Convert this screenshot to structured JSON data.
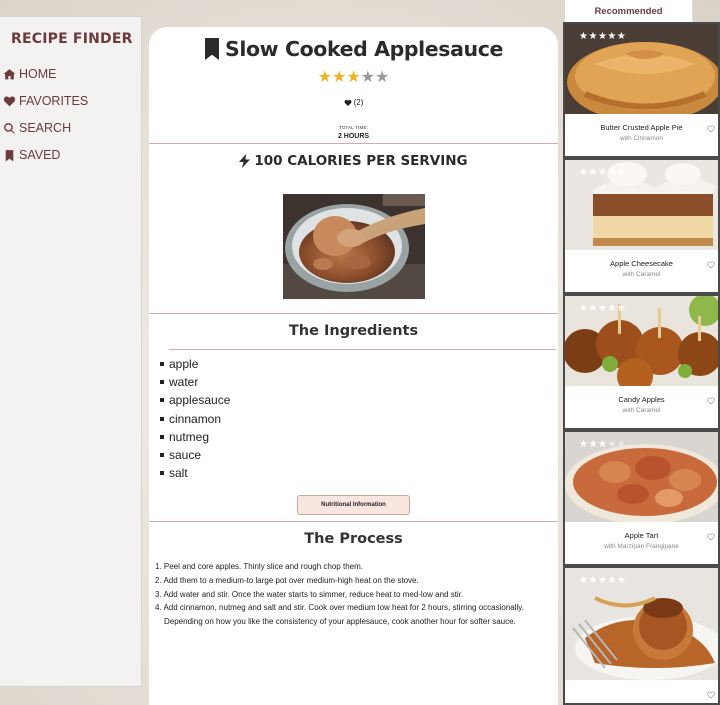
{
  "sidebar": {
    "brand": "RECIPE FINDER",
    "items": [
      {
        "label": "HOME",
        "icon": "home-icon"
      },
      {
        "label": "FAVORITES",
        "icon": "heart-icon"
      },
      {
        "label": "SEARCH",
        "icon": "search-icon"
      },
      {
        "label": "SAVED",
        "icon": "bookmark-icon"
      }
    ]
  },
  "recipe": {
    "title": "Slow Cooked Applesauce",
    "rating": 3,
    "rating_max": 5,
    "likes": "(2)",
    "time_label": "TOTAL TIME:",
    "time_value": "2 HOURS",
    "calories": "100 CALORIES PER SERVING",
    "ingredients_heading": "The Ingredients",
    "ingredients": [
      "apple",
      "water",
      "applesauce",
      "cinnamon",
      "nutmeg",
      "sauce",
      "salt"
    ],
    "nutrition_button": "Nutritional Information",
    "process_heading": "The Process",
    "steps": [
      "1. Peel and core apples. Thinly slice and rough chop them.",
      "2. Add them to a medium-to large pot over medium-high heat on the stove.",
      "3. Add water and stir. Once the water starts to simmer, reduce heat to med-low and stir.",
      "4. Add cinnamon, nutmeg and salt and stir. Cook over medium low heat for 2 hours, stirring occasionally. Depending on how you like the consistency of your applesauce, cook another hour for softer sauce."
    ]
  },
  "recommended": {
    "tab_label": "Recommended",
    "items": [
      {
        "name": "Butter Crusted Apple Pie",
        "subtitle": "with Cinnamon",
        "rating": 5
      },
      {
        "name": "Apple Cheesecake",
        "subtitle": "with Caramel",
        "rating": 5
      },
      {
        "name": "Candy Apples",
        "subtitle": "with Caramel",
        "rating": 5
      },
      {
        "name": "Apple Tart",
        "subtitle": "with Marzipan Frangipane",
        "rating": 3
      },
      {
        "name": "",
        "subtitle": "",
        "rating": 5
      }
    ]
  },
  "colors": {
    "brand": "#6b3b3b",
    "star_on": "#f0b323",
    "star_off": "#9a9a9a",
    "divider": "#d9a7ae",
    "button_bg": "#f9e7df"
  }
}
